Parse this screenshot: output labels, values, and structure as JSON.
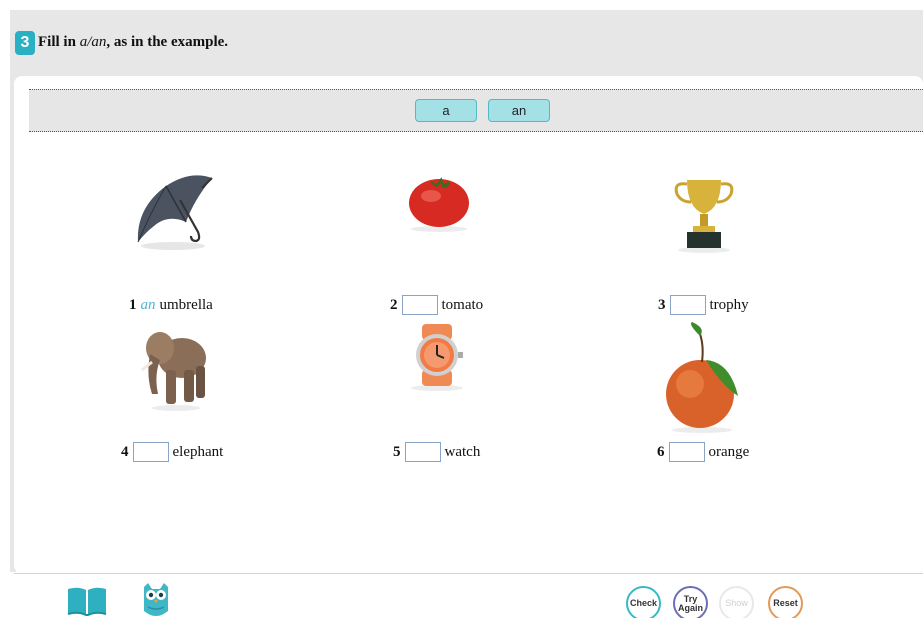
{
  "exercise": {
    "number": "3",
    "instruction_prefix": "Fill in ",
    "instruction_emph": "a/an",
    "instruction_suffix": ", as in the example."
  },
  "word_bank": {
    "options": [
      "a",
      "an"
    ]
  },
  "items": [
    {
      "number": "1",
      "answer": "an",
      "word": "umbrella",
      "icon": "umbrella-icon"
    },
    {
      "number": "2",
      "answer": "",
      "word": "tomato",
      "icon": "tomato-icon"
    },
    {
      "number": "3",
      "answer": "",
      "word": "trophy",
      "icon": "trophy-icon"
    },
    {
      "number": "4",
      "answer": "",
      "word": "elephant",
      "icon": "elephant-icon"
    },
    {
      "number": "5",
      "answer": "",
      "word": "watch",
      "icon": "watch-icon"
    },
    {
      "number": "6",
      "answer": "",
      "word": "orange",
      "icon": "orange-icon"
    }
  ],
  "footer": {
    "check_label": "Check",
    "try_again_line1": "Try",
    "try_again_line2": "Again",
    "show_label": "Show",
    "reset_label": "Reset",
    "book_icon": "book-icon",
    "owl_icon": "owl-icon"
  },
  "colors": {
    "accent": "#29b1c3",
    "chip_fill": "#a4e1e7",
    "answer_text": "#4fb3d9",
    "try_again_ring": "#6b6fb8",
    "reset_ring": "#e39a58"
  }
}
